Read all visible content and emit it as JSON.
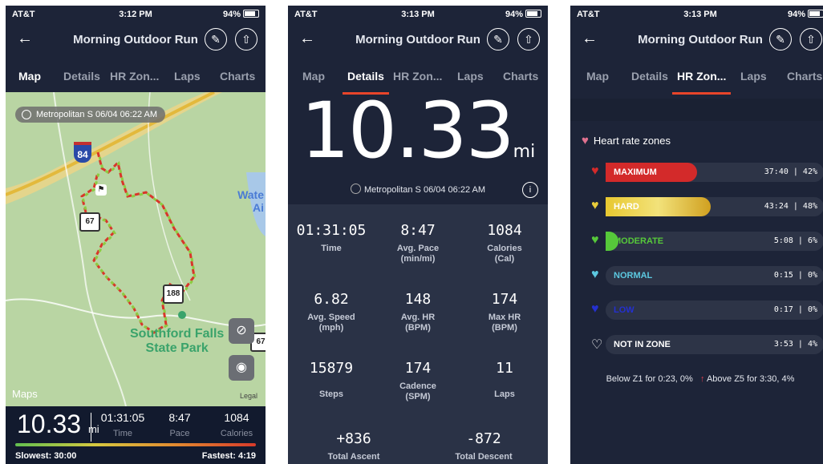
{
  "status": [
    {
      "carrier": "AT&T",
      "time": "3:12 PM",
      "battery": "94%"
    },
    {
      "carrier": "AT&T",
      "time": "3:13 PM",
      "battery": "94%"
    },
    {
      "carrier": "AT&T",
      "time": "3:13 PM",
      "battery": "94%"
    }
  ],
  "header": {
    "title": "Morning Outdoor Run"
  },
  "tabs": [
    "Map",
    "Details",
    "HR Zon...",
    "Laps",
    "Charts"
  ],
  "map": {
    "chip": "Metropolitan S 06/04 06:22 AM",
    "park": "Southford Falls\nState Park",
    "water": "Wate\nAi",
    "logo": "Maps",
    "legal": "Legal",
    "shield_84": "84",
    "shield_67": "67",
    "shield_188": "188",
    "shield_67b": "67"
  },
  "summary": {
    "distance": "10.33",
    "distance_unit": "mi",
    "time_value": "01:31:05",
    "time_label": "Time",
    "pace_value": "8:47",
    "pace_label": "Pace",
    "cal_value": "1084",
    "cal_label": "Calories",
    "slowest": "Slowest: 30:00",
    "fastest": "Fastest: 4:19"
  },
  "details": {
    "distance": "10.33",
    "unit": "mi",
    "line": "Metropolitan S 06/04 06:22 AM",
    "stats": [
      {
        "value": "01:31:05",
        "label": "Time"
      },
      {
        "value": "8:47",
        "label": "Avg. Pace\n(min/mi)"
      },
      {
        "value": "1084",
        "label": "Calories\n(Cal)"
      },
      {
        "value": "6.82",
        "label": "Avg. Speed\n(mph)"
      },
      {
        "value": "148",
        "label": "Avg. HR\n(BPM)"
      },
      {
        "value": "174",
        "label": "Max HR\n(BPM)"
      },
      {
        "value": "15879",
        "label": "Steps"
      },
      {
        "value": "174",
        "label": "Cadence\n(SPM)"
      },
      {
        "value": "11",
        "label": "Laps"
      }
    ],
    "ascent": {
      "value": "+836",
      "label": "Total Ascent"
    },
    "descent": {
      "value": "-872",
      "label": "Total Descent"
    }
  },
  "hr": {
    "title": "Heart rate zones",
    "zones": [
      {
        "name": "MAXIMUM",
        "value": "37:40 | 42%",
        "pct": 42,
        "color": "#d32a2a",
        "label_color": "#ffffff"
      },
      {
        "name": "HARD",
        "value": "43:24 | 48%",
        "pct": 48,
        "color": "#e8cc3a",
        "label_color": "#ffffff"
      },
      {
        "name": "MODERATE",
        "value": "5:08 | 6%",
        "pct": 6,
        "color": "#56c83a",
        "label_color": "#56c83a"
      },
      {
        "name": "NORMAL",
        "value": "0:15 | 0%",
        "pct": 0,
        "color": "#5cc8e0",
        "label_color": "#5cc8e0"
      },
      {
        "name": "LOW",
        "value": "0:17 | 0%",
        "pct": 0,
        "color": "#2430d0",
        "label_color": "#2430d0"
      },
      {
        "name": "NOT IN ZONE",
        "value": "3:53 | 4%",
        "pct": 4,
        "color": "#ffffff",
        "label_color": "#ffffff"
      }
    ],
    "below": "Below Z1 for 0:23, 0%",
    "above": "Above Z5 for 3:30, 4%"
  }
}
